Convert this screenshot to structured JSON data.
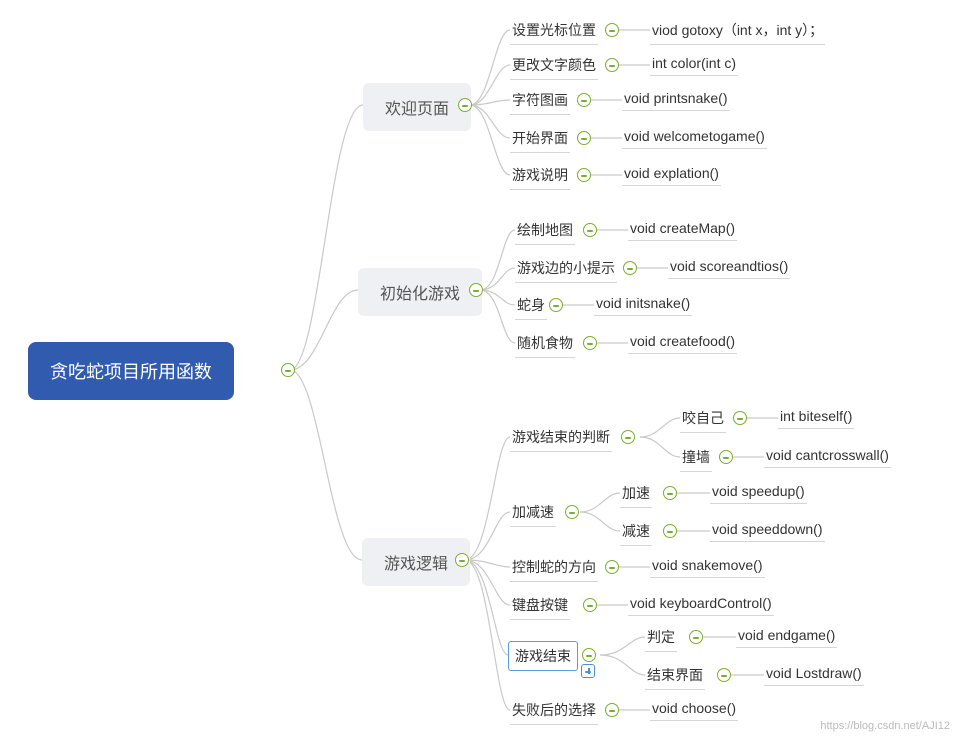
{
  "root": {
    "label": "贪吃蛇项目所用函数"
  },
  "branches": [
    {
      "id": "welcome",
      "label": "欢迎页面",
      "children": [
        {
          "label": "设置光标位置",
          "func": "viod gotoxy（int x，int y）；"
        },
        {
          "label": "更改文字颜色",
          "func": "int color(int c)"
        },
        {
          "label": "字符图画",
          "func": "void printsnake()"
        },
        {
          "label": "开始界面",
          "func": "void welcometogame()"
        },
        {
          "label": "游戏说明",
          "func": "void explation()"
        }
      ]
    },
    {
      "id": "init",
      "label": "初始化游戏",
      "children": [
        {
          "label": "绘制地图",
          "func": "void createMap()"
        },
        {
          "label": "游戏边的小提示",
          "func": "void scoreandtios()"
        },
        {
          "label": "蛇身",
          "func": "void initsnake()"
        },
        {
          "label": "随机食物",
          "func": "void createfood()"
        }
      ]
    },
    {
      "id": "logic",
      "label": "游戏逻辑",
      "children": [
        {
          "label": "游戏结束的判断",
          "children": [
            {
              "label": "咬自己",
              "func": "int biteself()"
            },
            {
              "label": "撞墙",
              "func": "void cantcrosswall()"
            }
          ]
        },
        {
          "label": "加减速",
          "children": [
            {
              "label": "加速",
              "func": "void speedup()"
            },
            {
              "label": "减速",
              "func": "void speeddown()"
            }
          ]
        },
        {
          "label": "控制蛇的方向",
          "func": "void snakemove()"
        },
        {
          "label": "键盘按键",
          "func": "void keyboardControl()"
        },
        {
          "label": "游戏结束",
          "selected": true,
          "children": [
            {
              "label": "判定",
              "func": "void endgame()"
            },
            {
              "label": "结束界面",
              "func": "void Lostdraw()"
            }
          ]
        },
        {
          "label": "失败后的选择",
          "func": "void choose()"
        }
      ]
    }
  ],
  "watermark": "https://blog.csdn.net/AJI12"
}
